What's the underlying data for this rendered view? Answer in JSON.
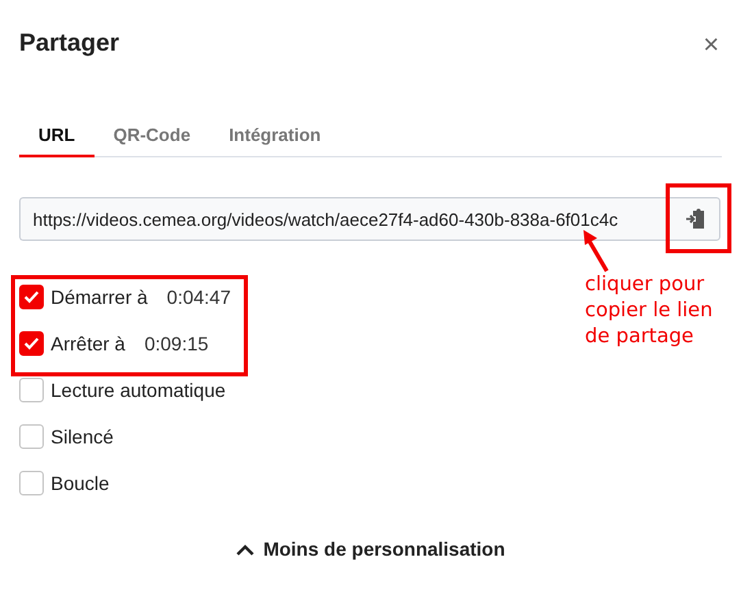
{
  "dialog": {
    "title": "Partager",
    "close": "×"
  },
  "tabs": [
    {
      "label": "URL",
      "selected": true
    },
    {
      "label": "QR-Code",
      "selected": false
    },
    {
      "label": "Intégration",
      "selected": false
    }
  ],
  "url_field": {
    "value": "https://videos.cemea.org/videos/watch/aece27f4-ad60-430b-838a-6f01c4c"
  },
  "options": [
    {
      "label": "Démarrer à",
      "checked": true,
      "time": "0:04:47"
    },
    {
      "label": "Arrêter à",
      "checked": true,
      "time": "0:09:15"
    },
    {
      "label": "Lecture automatique",
      "checked": false
    },
    {
      "label": "Silencé",
      "checked": false
    },
    {
      "label": "Boucle",
      "checked": false
    }
  ],
  "toggle_button": {
    "label": "Moins de personnalisation"
  },
  "annotation": {
    "text": "cliquer pour\ncopier le lien\nde partage"
  }
}
